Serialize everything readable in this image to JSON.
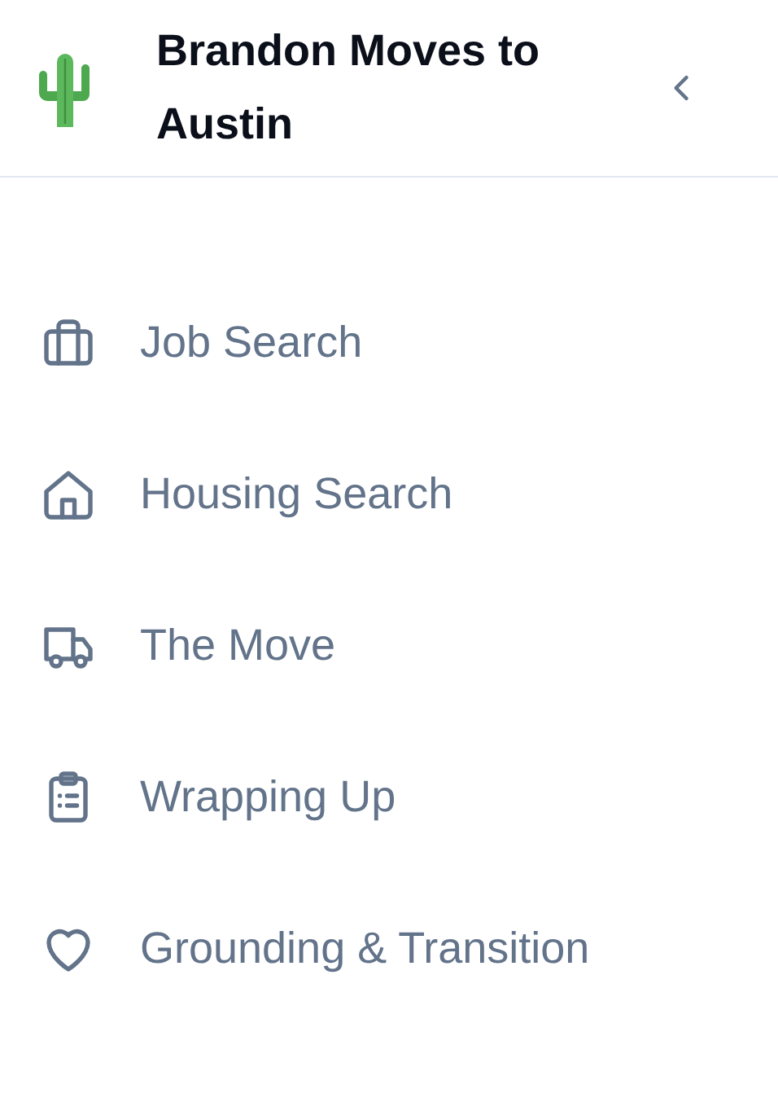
{
  "header": {
    "title": "Brandon Moves to Austin"
  },
  "nav": [
    {
      "label": "Job Search"
    },
    {
      "label": "Housing Search"
    },
    {
      "label": "The Move"
    },
    {
      "label": "Wrapping Up"
    },
    {
      "label": "Grounding & Transition"
    }
  ]
}
